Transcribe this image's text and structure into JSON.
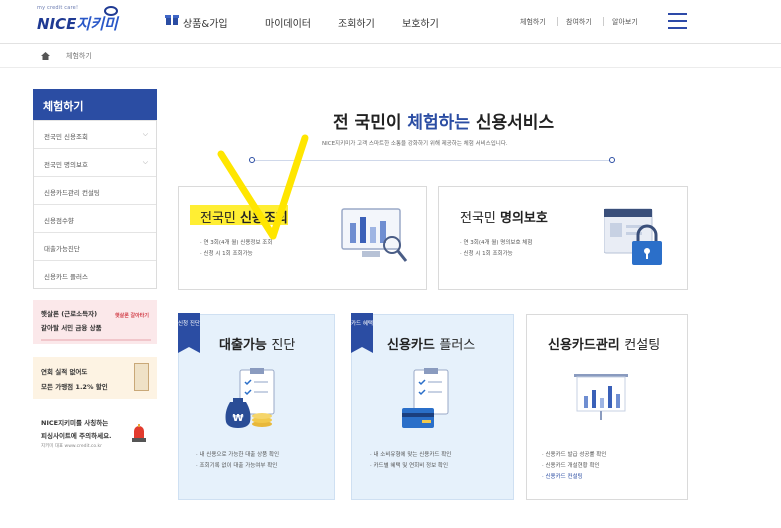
{
  "header": {
    "logo_tag": "my credit care!",
    "logo_text_a": "NICE",
    "logo_text_b": "지키미",
    "nav": [
      "상품&가입",
      "마이데이터",
      "조회하기",
      "보호하기"
    ],
    "util": [
      "체험하기",
      "참여하기",
      "알아보기"
    ]
  },
  "breadcrumb": {
    "current": "체험하기"
  },
  "sidebar": {
    "title": "체험하기",
    "items": [
      {
        "label": "전국민 신용조회",
        "has_chevron": true
      },
      {
        "label": "전국민 명의보호",
        "has_chevron": true
      },
      {
        "label": "신용카드관리 컨설팅",
        "has_chevron": false
      },
      {
        "label": "신용점수향",
        "has_chevron": false
      },
      {
        "label": "대출가능진단",
        "has_chevron": false
      },
      {
        "label": "신용카드 플러스",
        "has_chevron": false
      }
    ]
  },
  "banners": {
    "b1": {
      "line1": "햇살론 (근로소득자)",
      "line2": "갈아탈 서민 금융 상품",
      "deco": "햇살론 갈아타기"
    },
    "b2": {
      "line1": "연회 실적 없어도",
      "line2": "모든 가맹점 1.2% 할인"
    },
    "b3": {
      "line1": "NICE지키미를 사칭하는",
      "line2": "피싱사이트에 주의하세요.",
      "line3": "지키미 대표 www.credit.co.kr"
    }
  },
  "main": {
    "title_a": "전 국민이 ",
    "title_hl": "체험하는",
    "title_b": " 신용서비스",
    "subtitle": "NICE지키미가 고객 스마트한 소통을 강화하기 위해 제공하는 체험 서비스입니다."
  },
  "cards": {
    "credit": {
      "title_a": "전국민 ",
      "title_b": "신용조회",
      "bullets": [
        "· 연 3회(4개 월) 신용정보 조회",
        "· 신청 시 1회 조회가능"
      ]
    },
    "identity": {
      "title_a": "전국민 ",
      "title_b": "명의보호",
      "bullets": [
        "· 연 3회(4개 월) 명의보호 체험",
        "· 신청 시 1회 조회가능"
      ]
    },
    "loan": {
      "ribbon": "신청 진단",
      "title_a": "대출가능 ",
      "title_b": "진단",
      "bullets": [
        "· 내 신용으로 가능한 대출 상품 확인",
        "· 조회기록 없이 대출 가능여부 확인"
      ]
    },
    "cardplus": {
      "ribbon": "카드 혜택",
      "title_a": "신용카드 ",
      "title_b": "플러스",
      "bullets": [
        "· 내 소비유형에 맞는 신용카드 확인",
        "· 카드별 혜택 및 연회비 정보 확인"
      ]
    },
    "consult": {
      "title_a": "신용카드관리 ",
      "title_b": "컨설팅",
      "bullets": [
        "· 신용카드 발급 성공률 확인",
        "· 신용카드 개설현황 확인",
        "· 신용카드 컨설팅"
      ]
    }
  },
  "colors": {
    "brand": "#2b4da3",
    "highlight": "#ffee33",
    "card_blue": "#e6f1fb"
  }
}
